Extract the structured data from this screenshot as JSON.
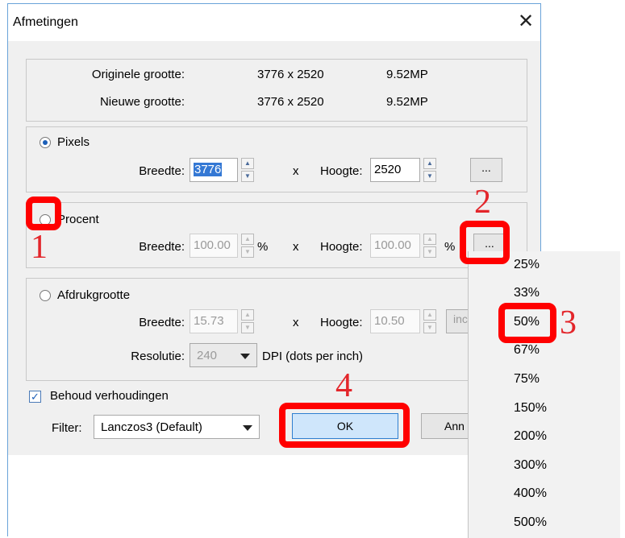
{
  "dialog": {
    "title": "Afmetingen",
    "close_glyph": "✕"
  },
  "summary": {
    "original_label": "Originele grootte:",
    "original_dims": "3776 x 2520",
    "original_mp": "9.52MP",
    "new_label": "Nieuwe grootte:",
    "new_dims": "3776 x 2520",
    "new_mp": "9.52MP"
  },
  "pixels": {
    "radio_label": "Pixels",
    "selected": true,
    "width_label": "Breedte:",
    "width_value": "3776",
    "x_label": "x",
    "height_label": "Hoogte:",
    "height_value": "2520",
    "more_button": "..."
  },
  "percent": {
    "radio_label": "Procent",
    "selected": false,
    "width_label": "Breedte:",
    "width_value": "100.00",
    "pct": "%",
    "x_label": "x",
    "height_label": "Hoogte:",
    "height_value": "100.00",
    "more_button": "..."
  },
  "print": {
    "radio_label": "Afdrukgrootte",
    "selected": false,
    "width_label": "Breedte:",
    "width_value": "15.73",
    "x_label": "x",
    "height_label": "Hoogte:",
    "height_value": "10.50",
    "unit_button": "inc",
    "resolution_label": "Resolutie:",
    "resolution_value": "240",
    "dpi_label": "DPI (dots per inch)"
  },
  "keep_ratio": {
    "label": "Behoud verhoudingen",
    "checked": true,
    "checkmark": "✓"
  },
  "filter": {
    "label": "Filter:",
    "value": "Lanczos3 (Default)"
  },
  "buttons": {
    "ok": "OK",
    "cancel": "Ann"
  },
  "percent_menu": {
    "items": [
      "25%",
      "33%",
      "50%",
      "67%",
      "75%",
      "150%",
      "200%",
      "300%",
      "400%",
      "500%"
    ]
  },
  "annotations": {
    "step1": "1",
    "step2": "2",
    "step3": "3",
    "step4": "4",
    "color": "#e3262b"
  }
}
